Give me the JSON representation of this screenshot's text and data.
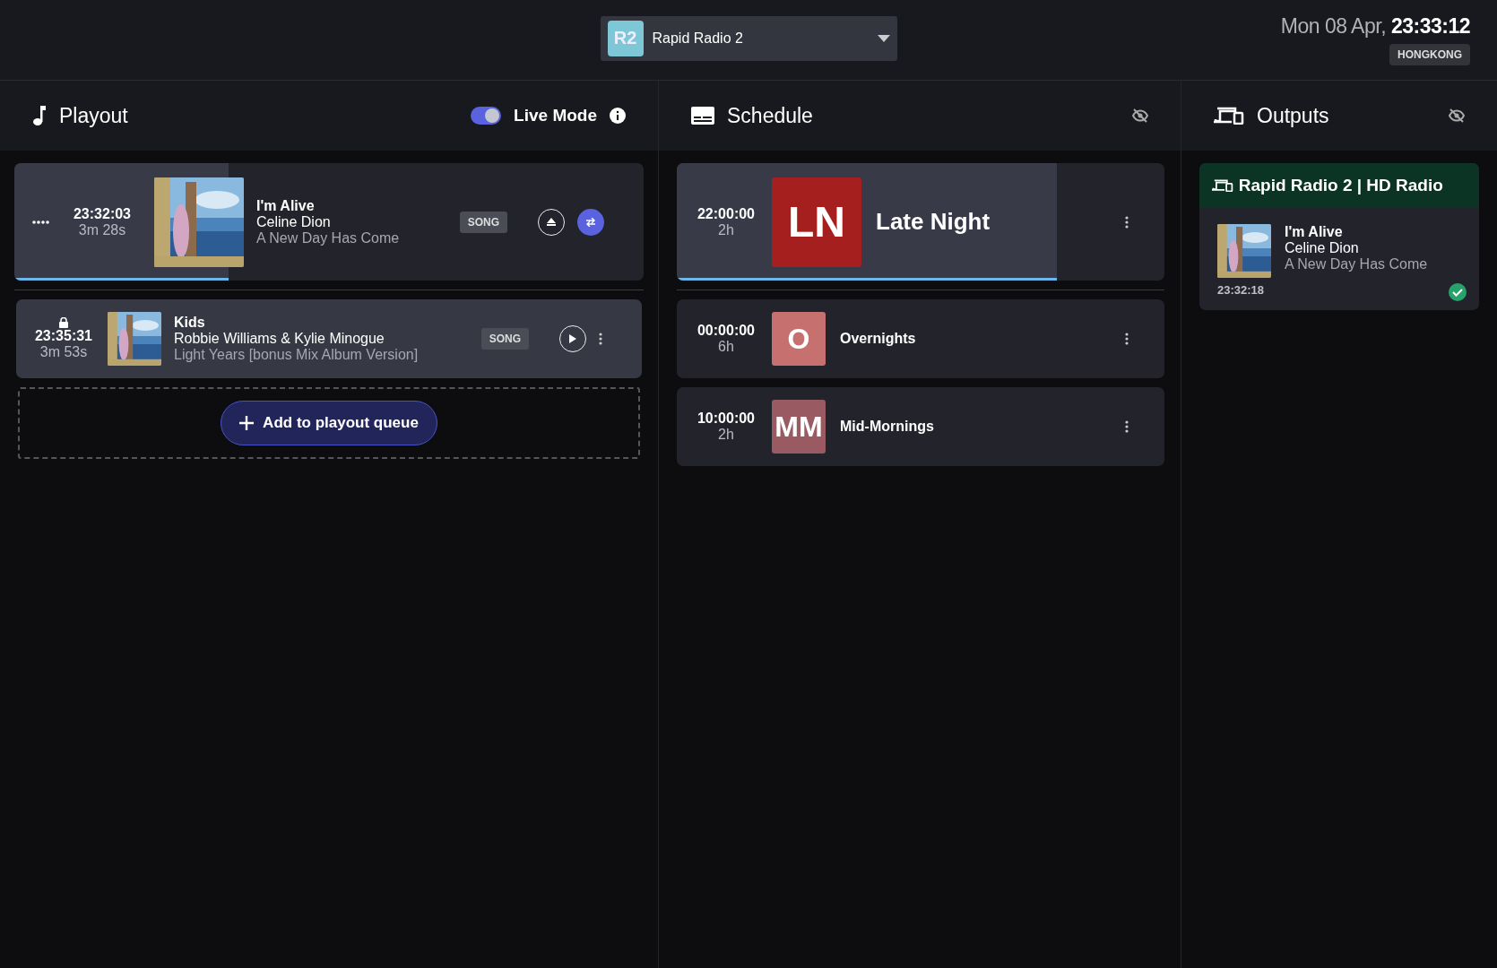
{
  "station_selector": {
    "badge": "R2",
    "name": "Rapid Radio 2"
  },
  "clock": {
    "date": "Mon 08 Apr,",
    "time": "23:33:12",
    "timezone": "HONGKONG"
  },
  "playout": {
    "title": "Playout",
    "live_mode": {
      "label": "Live Mode",
      "on": true
    },
    "items": [
      {
        "kind": "current",
        "time": "23:32:03",
        "duration": "3m 28s",
        "title": "I'm Alive",
        "artist": "Celine Dion",
        "album": "A New Day Has Come",
        "tag": "SONG",
        "level": 0.34
      },
      {
        "kind": "queued",
        "time": "23:35:31",
        "duration": "3m 53s",
        "title": "Kids",
        "artist": "Robbie Williams & Kylie Minogue",
        "album": "Light Years [bonus Mix Album Version]",
        "tag": "SONG"
      }
    ],
    "add_button": "Add to playout queue"
  },
  "schedule": {
    "title": "Schedule",
    "items": [
      {
        "kind": "current",
        "time": "22:00:00",
        "duration": "2h",
        "logo": "LN",
        "color": "#a51f1f",
        "name": "Late Night",
        "level": 0.78
      },
      {
        "kind": "upcoming",
        "time": "00:00:00",
        "duration": "6h",
        "logo": "O",
        "color": "#c77070",
        "name": "Overnights"
      },
      {
        "kind": "upcoming",
        "time": "10:00:00",
        "duration": "2h",
        "logo": "MM",
        "color": "#9a5a62",
        "name": "Mid-Mornings"
      }
    ]
  },
  "outputs": {
    "title": "Outputs",
    "items": [
      {
        "name": "Rapid Radio 2 | HD Radio",
        "title": "I'm Alive",
        "artist": "Celine Dion",
        "album": "A New Day Has Come",
        "time": "23:32:18",
        "ok": true
      }
    ]
  }
}
